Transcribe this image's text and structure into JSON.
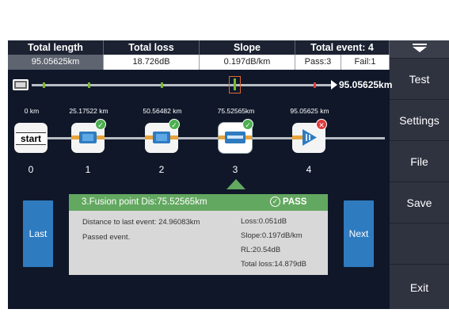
{
  "summary": {
    "headers": [
      "Total length",
      "Total loss",
      "Slope",
      "Total event: 4"
    ],
    "values": [
      "95.05625km",
      "18.726dB",
      "0.197dB/km"
    ],
    "pass": "Pass:3",
    "fail": "Fail:1"
  },
  "trace": {
    "total_distance": "95.05625km"
  },
  "events": [
    {
      "index": "0",
      "distance": "0 km",
      "label": "start",
      "status": "none"
    },
    {
      "index": "1",
      "distance": "25.17522 km",
      "status": "pass"
    },
    {
      "index": "2",
      "distance": "50.56482 km",
      "status": "pass"
    },
    {
      "index": "3",
      "distance": "75.52565km",
      "status": "pass",
      "selected": true
    },
    {
      "index": "4",
      "distance": "95.05625 km",
      "status": "fail"
    }
  ],
  "detail": {
    "title": "3.Fusion point   Dis:75.52565km",
    "result": "PASS",
    "distance_to_last": "Distance to last event: 24.96083km",
    "status_text": "Passed event.",
    "loss": "Loss:0.051dB",
    "slope": "Slope:0.197dB/km",
    "rl": "RL:20.54dB",
    "total_loss": "Total loss:14.879dB"
  },
  "nav": {
    "last": "Last",
    "next": "Next"
  },
  "menu": [
    "Test",
    "Settings",
    "File",
    "Save",
    "",
    "Exit"
  ],
  "colors": {
    "pass": "#63a860",
    "fail": "#e03a3a",
    "accent_blue": "#2f7bc0",
    "selection": "#e06a30"
  }
}
